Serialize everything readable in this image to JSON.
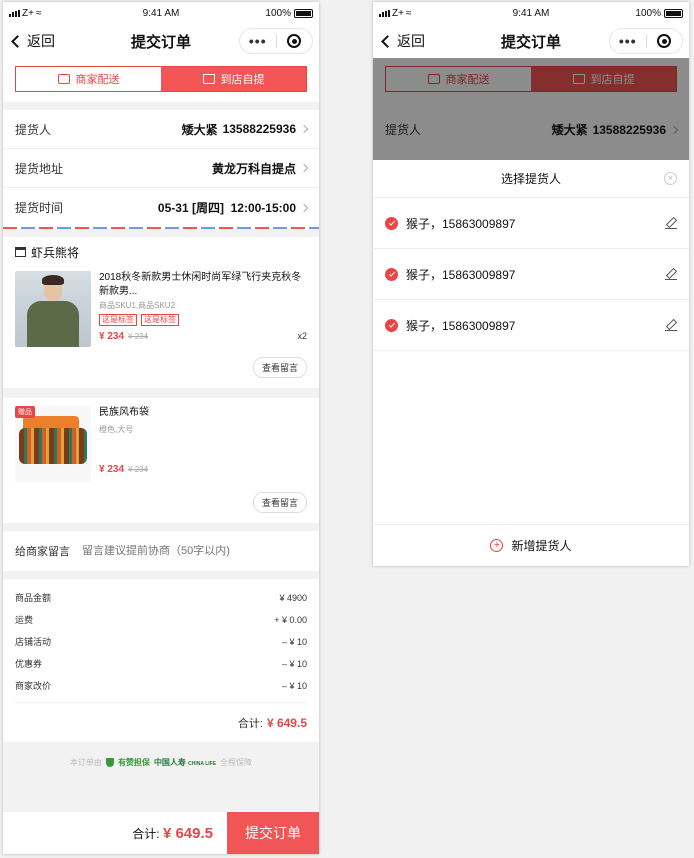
{
  "status_bar": {
    "carrier": "Z+",
    "time": "9:41 AM",
    "battery": "100%"
  },
  "nav": {
    "back_label": "返回",
    "title": "提交订单",
    "more_label": "•••"
  },
  "delivery_tabs": [
    {
      "label": "商家配送",
      "icon": "truck-icon",
      "active": false
    },
    {
      "label": "到店自提",
      "icon": "shopping-bag-icon",
      "active": true
    }
  ],
  "pickup": {
    "person_label": "提货人",
    "person_name": "矮大紧",
    "person_phone": "13588225936",
    "address_label": "提货地址",
    "address_value": "黄龙万科自提点",
    "time_label": "提货时间",
    "time_value": "05-31 [周四]  12:00-15:00"
  },
  "shop": {
    "name": "虾兵熊将"
  },
  "goods": [
    {
      "title": "2018秋冬新款男士休闲时尚军绿飞行夹克秋冬新款男...",
      "sku": "商品SKU1,商品SKU2",
      "tags": [
        "这是标签",
        "这是标签"
      ],
      "price": "¥ 234",
      "original_price": "¥ 234",
      "qty": "x2",
      "message_button": "查看留言",
      "gift_badge": ""
    },
    {
      "title": "民族风布袋",
      "sku": "橙色,大号",
      "tags": [],
      "price": "¥ 234",
      "original_price": "¥ 234",
      "qty": "",
      "message_button": "查看留言",
      "gift_badge": "赠品"
    }
  ],
  "remark": {
    "label": "给商家留言",
    "placeholder": "留言建议提前协商（50字以内)"
  },
  "summary": {
    "rows": [
      {
        "label": "商品金额",
        "value": "¥ 4900"
      },
      {
        "label": "运费",
        "value": "+ ¥ 0.00"
      },
      {
        "label": "店铺活动",
        "value": "– ¥ 10"
      },
      {
        "label": "优惠券",
        "value": "– ¥ 10"
      },
      {
        "label": "商家改价",
        "value": "– ¥ 10"
      }
    ],
    "total_label": "合计:",
    "total_value": "¥ 649.5"
  },
  "guarantee": {
    "prefix": "本订单由",
    "brand": "有赞担保",
    "insurer": "中国人寿",
    "insurer_sub": "CHINA LIFE",
    "suffix": "全程保障"
  },
  "bottom_bar": {
    "total_label": "合计:",
    "total_value": "¥ 649.5",
    "submit_label": "提交订单"
  },
  "picker": {
    "title": "选择提货人",
    "close_icon": "×",
    "persons": [
      {
        "name": "猴子，15863009897"
      },
      {
        "name": "猴子，15863009897"
      },
      {
        "name": "猴子，15863009897"
      }
    ],
    "add_label": "新增提货人",
    "add_icon": "+"
  },
  "colors": {
    "accent": "#f25555",
    "accent_text": "#e94545",
    "link_blue": "#6b9be6",
    "guarantee_green": "#3a9a3a"
  }
}
